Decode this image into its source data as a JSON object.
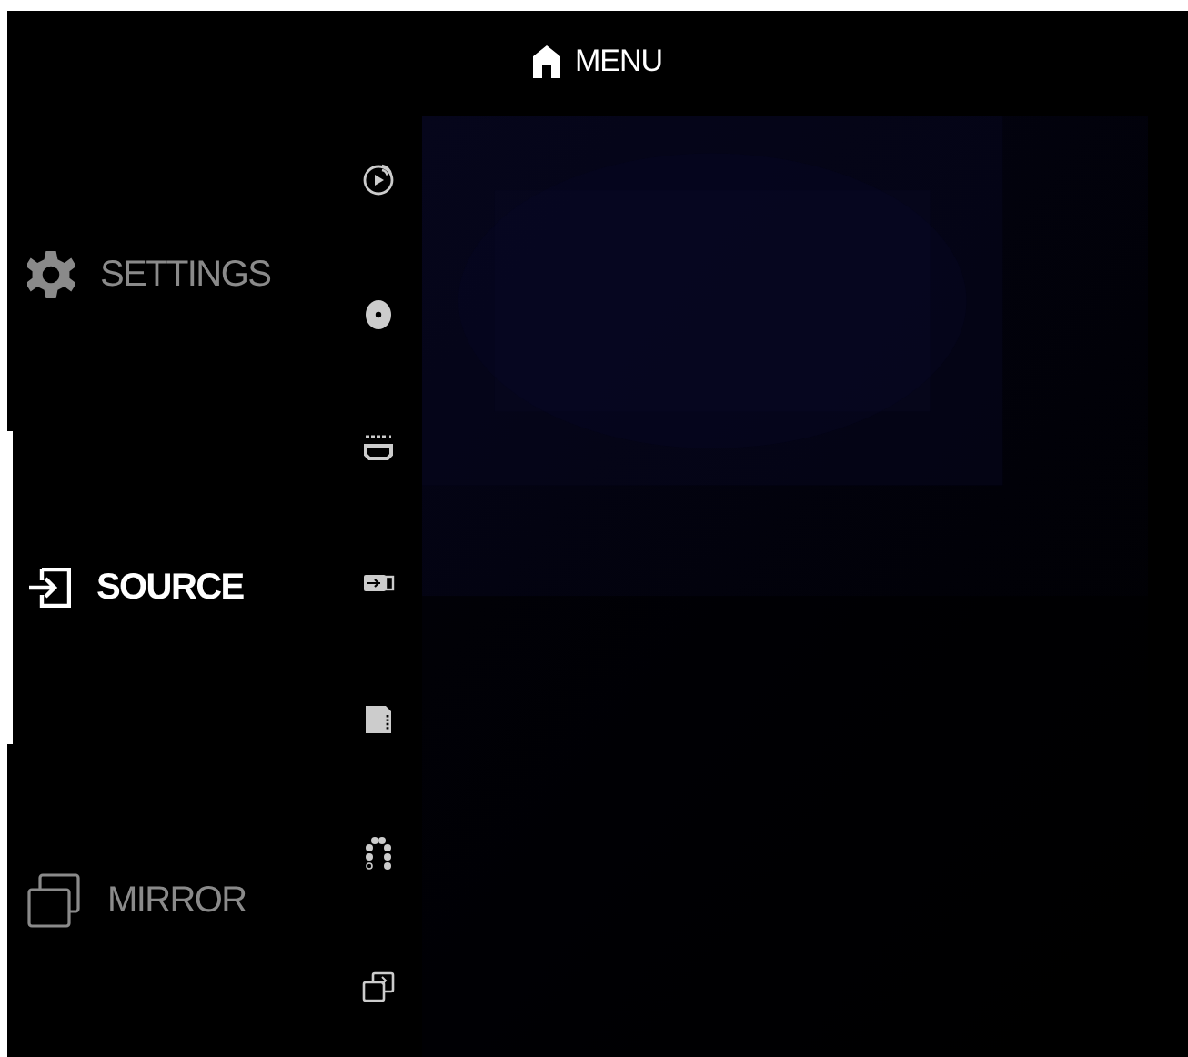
{
  "header": {
    "title": "MENU"
  },
  "menu": [
    {
      "kind": "settings",
      "label": "SETTINGS",
      "selected": false
    },
    {
      "kind": "source",
      "label": "SOURCE",
      "selected": true
    },
    {
      "kind": "mirror",
      "label": "MIRROR",
      "selected": false
    }
  ],
  "sources": [
    {
      "kind": "cast"
    },
    {
      "kind": "disc"
    },
    {
      "kind": "hdmi"
    },
    {
      "kind": "usb"
    },
    {
      "kind": "sd-card"
    },
    {
      "kind": "dots"
    },
    {
      "kind": "mirror"
    }
  ]
}
